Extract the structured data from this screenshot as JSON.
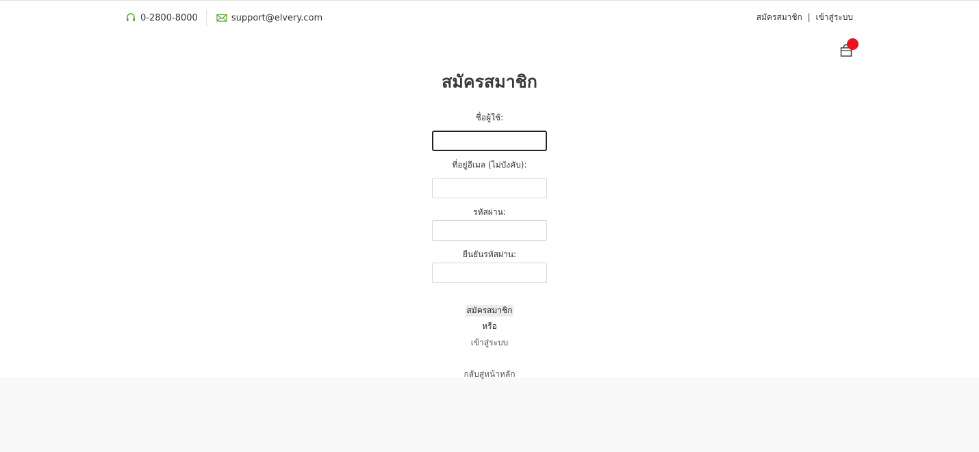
{
  "header": {
    "phone": "0-2800-8000",
    "email": "support@elvery.com",
    "register_link": "สมัครสมาชิก",
    "separator": "|",
    "login_link": "เข้าสู่ระบบ",
    "icons": {
      "phone": "headset-icon",
      "email": "envelope-icon",
      "cart": "shopping-bag-icon"
    },
    "accent_color": "#5aa02c",
    "badge_color": "#e8141e"
  },
  "form": {
    "title": "สมัครสมาชิก",
    "fields": [
      {
        "label": "ชื่อผู้ใช้:",
        "value": ""
      },
      {
        "label": "ที่อยู่อีเมล (ไม่บังคับ):",
        "value": ""
      },
      {
        "label": "รหัสผ่าน:",
        "value": ""
      },
      {
        "label": "ยืนยันรหัสผ่าน:",
        "value": ""
      }
    ],
    "submit_label": "สมัครสมาชิก",
    "or_text": "หรือ",
    "login_link": "เข้าสู่ระบบ",
    "home_link": "กลับสู่หน้าหลัก"
  }
}
